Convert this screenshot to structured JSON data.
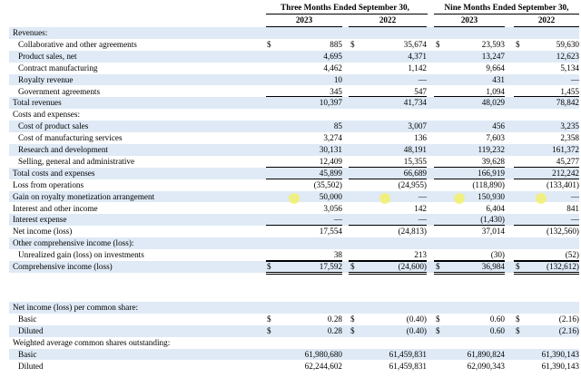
{
  "header": {
    "three_months": "Three Months Ended September 30,",
    "nine_months": "Nine Months Ended September 30,",
    "years": [
      "2023",
      "2022",
      "2023",
      "2022"
    ]
  },
  "rows": [
    {
      "label": "Revenues:",
      "indent": 0,
      "shaded": true,
      "values": [
        "",
        "",
        "",
        ""
      ],
      "dollars": [
        false,
        false,
        false,
        false
      ],
      "underline": false,
      "double": false
    },
    {
      "label": "Collaborative and other agreements",
      "indent": 1,
      "shaded": false,
      "values": [
        "885",
        "35,674",
        "23,593",
        "59,630"
      ],
      "dollars": [
        true,
        true,
        true,
        true
      ],
      "underline": false,
      "double": false
    },
    {
      "label": "Product sales, net",
      "indent": 1,
      "shaded": true,
      "values": [
        "4,695",
        "4,371",
        "13,247",
        "12,623"
      ],
      "dollars": [
        false,
        false,
        false,
        false
      ],
      "underline": false,
      "double": false
    },
    {
      "label": "Contract manufacturing",
      "indent": 1,
      "shaded": false,
      "values": [
        "4,462",
        "1,142",
        "9,664",
        "5,134"
      ],
      "dollars": [
        false,
        false,
        false,
        false
      ],
      "underline": false,
      "double": false
    },
    {
      "label": "Royalty revenue",
      "indent": 1,
      "shaded": true,
      "values": [
        "10",
        "—",
        "431",
        "—"
      ],
      "dollars": [
        false,
        false,
        false,
        false
      ],
      "underline": false,
      "double": false
    },
    {
      "label": "Government agreements",
      "indent": 1,
      "shaded": false,
      "values": [
        "345",
        "547",
        "1,094",
        "1,455"
      ],
      "dollars": [
        false,
        false,
        false,
        false
      ],
      "underline": true,
      "double": false
    },
    {
      "label": "Total revenues",
      "indent": 0,
      "shaded": true,
      "values": [
        "10,397",
        "41,734",
        "48,029",
        "78,842"
      ],
      "dollars": [
        false,
        false,
        false,
        false
      ],
      "underline": false,
      "double": false
    },
    {
      "label": "Costs and expenses:",
      "indent": 0,
      "shaded": false,
      "values": [
        "",
        "",
        "",
        ""
      ],
      "dollars": [
        false,
        false,
        false,
        false
      ],
      "underline": false,
      "double": false
    },
    {
      "label": "Cost of product sales",
      "indent": 1,
      "shaded": true,
      "values": [
        "85",
        "3,007",
        "456",
        "3,235"
      ],
      "dollars": [
        false,
        false,
        false,
        false
      ],
      "underline": false,
      "double": false
    },
    {
      "label": "Cost of manufacturing services",
      "indent": 1,
      "shaded": false,
      "values": [
        "3,274",
        "136",
        "7,603",
        "2,358"
      ],
      "dollars": [
        false,
        false,
        false,
        false
      ],
      "underline": false,
      "double": false
    },
    {
      "label": "Research and development",
      "indent": 1,
      "shaded": true,
      "values": [
        "30,131",
        "48,191",
        "119,232",
        "161,372"
      ],
      "dollars": [
        false,
        false,
        false,
        false
      ],
      "underline": false,
      "double": false
    },
    {
      "label": "Selling, general and administrative",
      "indent": 1,
      "shaded": false,
      "values": [
        "12,409",
        "15,355",
        "39,628",
        "45,277"
      ],
      "dollars": [
        false,
        false,
        false,
        false
      ],
      "underline": true,
      "double": false
    },
    {
      "label": "Total costs and expenses",
      "indent": 0,
      "shaded": true,
      "values": [
        "45,899",
        "66,689",
        "166,919",
        "212,242"
      ],
      "dollars": [
        false,
        false,
        false,
        false
      ],
      "underline": true,
      "double": false
    },
    {
      "label": "Loss from operations",
      "indent": 0,
      "shaded": false,
      "values": [
        "(35,502)",
        "(24,955)",
        "(118,890)",
        "(133,401)"
      ],
      "dollars": [
        false,
        false,
        false,
        false
      ],
      "underline": false,
      "double": false
    },
    {
      "label": "Gain on royalty monetization arrangement",
      "indent": 0,
      "shaded": true,
      "values": [
        "50,000",
        "—",
        "150,930",
        "—"
      ],
      "dollars": [
        false,
        false,
        false,
        false
      ],
      "underline": false,
      "double": false,
      "marks": true
    },
    {
      "label": "Interest and other income",
      "indent": 0,
      "shaded": false,
      "values": [
        "3,056",
        "142",
        "6,404",
        "841"
      ],
      "dollars": [
        false,
        false,
        false,
        false
      ],
      "underline": false,
      "double": false
    },
    {
      "label": "Interest expense",
      "indent": 0,
      "shaded": true,
      "values": [
        "—",
        "—",
        "(1,430)",
        "—"
      ],
      "dollars": [
        false,
        false,
        false,
        false
      ],
      "underline": true,
      "double": false
    },
    {
      "label": "Net income (loss)",
      "indent": 0,
      "shaded": false,
      "values": [
        "17,554",
        "(24,813)",
        "37,014",
        "(132,560)"
      ],
      "dollars": [
        false,
        false,
        false,
        false
      ],
      "underline": false,
      "double": false
    },
    {
      "label": "Other comprehensive income (loss):",
      "indent": 0,
      "shaded": true,
      "values": [
        "",
        "",
        "",
        ""
      ],
      "dollars": [
        false,
        false,
        false,
        false
      ],
      "underline": false,
      "double": false
    },
    {
      "label": "Unrealized gain (loss) on investments",
      "indent": 1,
      "shaded": false,
      "values": [
        "38",
        "213",
        "(30)",
        "(52)"
      ],
      "dollars": [
        false,
        false,
        false,
        false
      ],
      "underline": true,
      "double": false
    },
    {
      "label": "Comprehensive income (loss)",
      "indent": 0,
      "shaded": true,
      "values": [
        "17,592",
        "(24,600)",
        "36,984",
        "(132,612)"
      ],
      "dollars": [
        true,
        true,
        true,
        true
      ],
      "underline": false,
      "double": true
    }
  ],
  "rows2": [
    {
      "label": "Net income (loss) per common share:",
      "indent": 0,
      "shaded": true,
      "values": [
        "",
        "",
        "",
        ""
      ],
      "dollars": [
        false,
        false,
        false,
        false
      ],
      "underline": false,
      "double": false
    },
    {
      "label": "Basic",
      "indent": 1,
      "shaded": false,
      "values": [
        "0.28",
        "(0.40)",
        "0.60",
        "(2.16)"
      ],
      "dollars": [
        true,
        true,
        true,
        true
      ],
      "underline": false,
      "double": false
    },
    {
      "label": "Diluted",
      "indent": 1,
      "shaded": true,
      "values": [
        "0.28",
        "(0.40)",
        "0.60",
        "(2.16)"
      ],
      "dollars": [
        true,
        true,
        true,
        true
      ],
      "underline": false,
      "double": false
    },
    {
      "label": "Weighted average common shares outstanding:",
      "indent": 0,
      "shaded": false,
      "values": [
        "",
        "",
        "",
        ""
      ],
      "dollars": [
        false,
        false,
        false,
        false
      ],
      "underline": false,
      "double": false
    },
    {
      "label": "Basic",
      "indent": 1,
      "shaded": true,
      "values": [
        "61,980,680",
        "61,459,831",
        "61,890,824",
        "61,390,143"
      ],
      "dollars": [
        false,
        false,
        false,
        false
      ],
      "underline": false,
      "double": false
    },
    {
      "label": "Diluted",
      "indent": 1,
      "shaded": false,
      "values": [
        "62,244,602",
        "61,459,831",
        "62,090,343",
        "61,390,143"
      ],
      "dollars": [
        false,
        false,
        false,
        false
      ],
      "underline": false,
      "double": false
    }
  ],
  "dollar_sign": "$",
  "colors": {
    "shade": "#dfeaf6",
    "highlight": "#f3f06d"
  }
}
